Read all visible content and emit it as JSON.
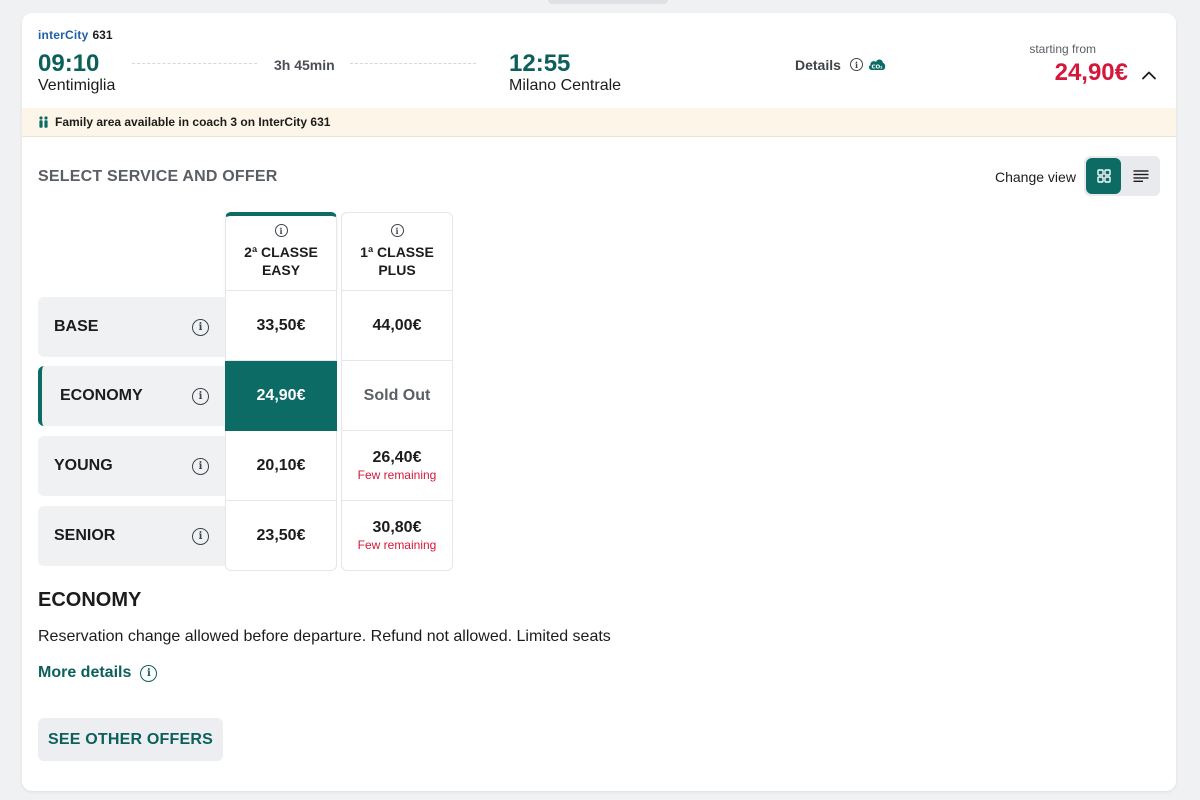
{
  "train": {
    "brand": "interCity",
    "number": "631"
  },
  "journey": {
    "departure_time": "09:10",
    "departure_station": "Ventimiglia",
    "duration": "3h 45min",
    "arrival_time": "12:55",
    "arrival_station": "Milano Centrale",
    "details_label": "Details",
    "starting_from_label": "starting from",
    "starting_price": "24,90€"
  },
  "notice": {
    "text": "Family area available in coach 3 on InterCity 631"
  },
  "section": {
    "title": "SELECT SERVICE AND OFFER",
    "change_view_label": "Change view"
  },
  "classes": [
    {
      "line1": "2ª CLASSE",
      "line2": "EASY"
    },
    {
      "line1": "1ª CLASSE",
      "line2": "PLUS"
    }
  ],
  "offers": [
    {
      "name": "BASE",
      "prices": [
        "33,50€",
        "44,00€"
      ],
      "notes": [
        "",
        ""
      ]
    },
    {
      "name": "ECONOMY",
      "prices": [
        "24,90€",
        "Sold Out"
      ],
      "notes": [
        "",
        ""
      ]
    },
    {
      "name": "YOUNG",
      "prices": [
        "20,10€",
        "26,40€"
      ],
      "notes": [
        "",
        "Few remaining"
      ]
    },
    {
      "name": "SENIOR",
      "prices": [
        "23,50€",
        "30,80€"
      ],
      "notes": [
        "",
        "Few remaining"
      ]
    }
  ],
  "selected_offer": {
    "title": "ECONOMY",
    "description": "Reservation change allowed before departure. Refund not allowed. Limited seats",
    "more_details_label": "More details"
  },
  "actions": {
    "see_other_offers": "SEE OTHER OFFERS"
  },
  "colors": {
    "accent": "#0c6b65",
    "price_red": "#d4183b",
    "notice_bg": "#fdf6e8"
  }
}
